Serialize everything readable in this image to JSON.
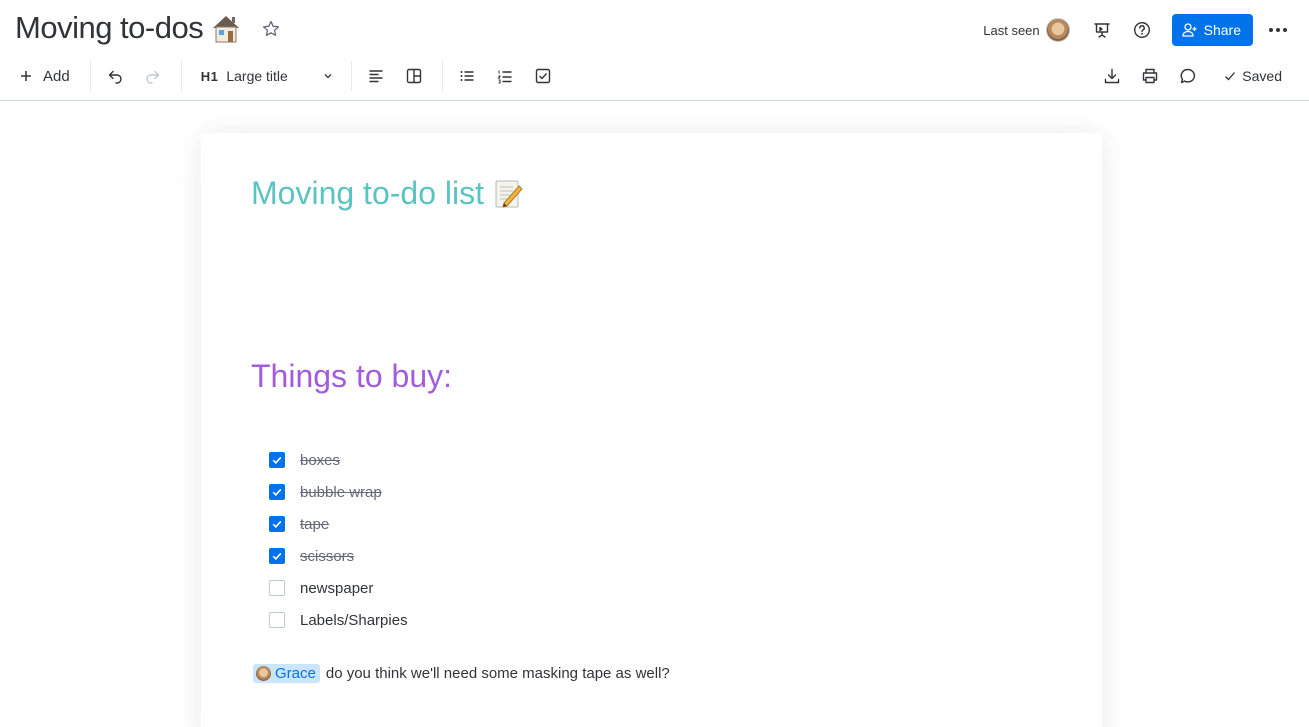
{
  "header": {
    "title": "Moving to-dos",
    "title_icon": "house-icon",
    "favorite_icon": "star-icon",
    "last_seen_label": "Last seen",
    "share_label": "Share",
    "icons": [
      "present-icon",
      "help-icon",
      "more-icon"
    ]
  },
  "toolbar": {
    "add_label": "Add",
    "heading_prefix": "H1",
    "heading_label": "Large title",
    "saved_label": "Saved",
    "icons": [
      "undo-icon",
      "redo-icon",
      "align-left-icon",
      "layout-icon",
      "bulleted-list-icon",
      "numbered-list-icon",
      "checklist-icon",
      "download-icon",
      "print-icon",
      "comment-icon",
      "check-icon"
    ]
  },
  "doc": {
    "title": "Moving to-do list",
    "title_icon": "memo-icon",
    "section_title": "Things to buy:",
    "checklist": [
      {
        "text": "boxes",
        "checked": true
      },
      {
        "text": "bubble wrap",
        "checked": true
      },
      {
        "text": "tape",
        "checked": true
      },
      {
        "text": "scissors",
        "checked": true
      },
      {
        "text": "newspaper",
        "checked": false
      },
      {
        "text": "Labels/Sharpies",
        "checked": false
      }
    ],
    "mention_name": "Grace",
    "mention_text": "do you think we'll need some masking tape as well?"
  },
  "colors": {
    "accent": "#0073ea",
    "title_teal": "#5cc4c0",
    "section_purple": "#a25ddc"
  }
}
